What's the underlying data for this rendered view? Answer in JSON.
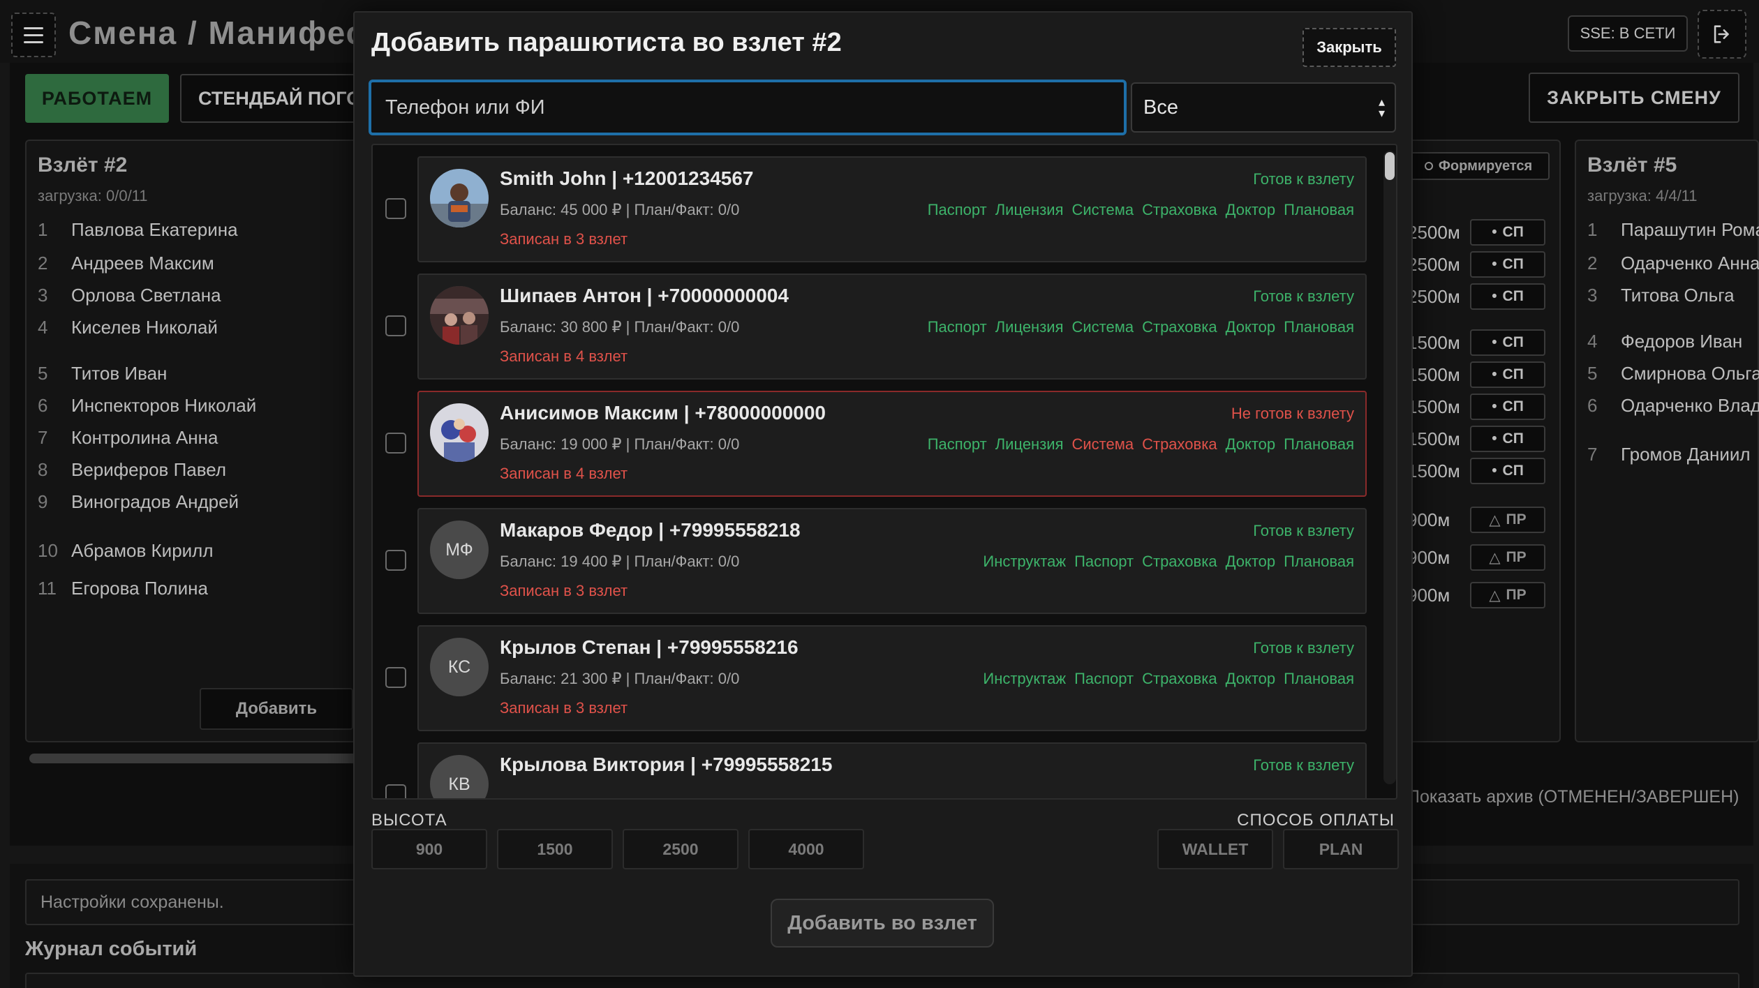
{
  "app": {
    "title": "Смена / Манифест",
    "sse_status": "SSE: В СЕТИ",
    "tab_working": "РАБОТАЕМ",
    "tab_standby": "СТЕНДБАЙ ПОГОДА",
    "close_shift": "ЗАКРЫТЬ СМЕНУ"
  },
  "left_card": {
    "title": "Взлёт #2",
    "load": "загрузка: 0/0/11",
    "add_label": "Добавить",
    "people": [
      {
        "n": "1",
        "name": "Павлова Екатерина"
      },
      {
        "n": "2",
        "name": "Андреев Максим"
      },
      {
        "n": "3",
        "name": "Орлова Светлана"
      },
      {
        "n": "4",
        "name": "Киселев Николай"
      },
      {
        "n": "5",
        "name": "Титов Иван"
      },
      {
        "n": "6",
        "name": "Инспекторов Николай"
      },
      {
        "n": "7",
        "name": "Контролина Анна"
      },
      {
        "n": "8",
        "name": "Вериферов Павел"
      },
      {
        "n": "9",
        "name": "Виноградов Андрей"
      },
      {
        "n": "10",
        "name": "Абрамов Кирилл"
      },
      {
        "n": "11",
        "name": "Егорова Полина"
      }
    ]
  },
  "mid_card": {
    "status": "Формируется",
    "rows": [
      {
        "alt": "2500м",
        "tag": "СП",
        "kind": "sp"
      },
      {
        "alt": "2500м",
        "tag": "СП",
        "kind": "sp"
      },
      {
        "alt": "2500м",
        "tag": "СП",
        "kind": "sp"
      },
      {
        "alt": "1500м",
        "tag": "СП",
        "kind": "sp"
      },
      {
        "alt": "1500м",
        "tag": "СП",
        "kind": "sp"
      },
      {
        "alt": "1500м",
        "tag": "СП",
        "kind": "sp"
      },
      {
        "alt": "1500м",
        "tag": "СП",
        "kind": "sp"
      },
      {
        "alt": "1500м",
        "tag": "СП",
        "kind": "sp"
      },
      {
        "alt": "900м",
        "tag": "ПР",
        "kind": "pr"
      },
      {
        "alt": "900м",
        "tag": "ПР",
        "kind": "pr"
      },
      {
        "alt": "900м",
        "tag": "ПР",
        "kind": "pr"
      }
    ],
    "archive": "Показать архив (ОТМЕНЕН/ЗАВЕРШЕН)"
  },
  "right_card": {
    "title": "Взлёт #5",
    "load": "загрузка: 4/4/11",
    "people": [
      {
        "n": "1",
        "name": "Парашутин Роман"
      },
      {
        "n": "2",
        "name": "Одарченко Анна"
      },
      {
        "n": "3",
        "name": "Титова Ольга"
      },
      {
        "n": "4",
        "name": "Федоров Иван"
      },
      {
        "n": "5",
        "name": "Смирнова Ольга"
      },
      {
        "n": "6",
        "name": "Одарченко Влад"
      },
      {
        "n": "7",
        "name": "Громов Даниил"
      }
    ]
  },
  "bottom": {
    "toast": "Настройки сохранены.",
    "journal_title": "Журнал событий"
  },
  "modal": {
    "title": "Добавить парашютиста во взлет #2",
    "close_label": "Закрыть",
    "search_placeholder": "Телефон или ФИ",
    "filter_value": "Все",
    "altitude_label": "ВЫСОТА",
    "payment_label": "СПОСОБ ОПЛАТЫ",
    "altitudes": [
      "900",
      "1500",
      "2500",
      "4000"
    ],
    "payments": [
      "WALLET",
      "PLAN"
    ],
    "submit_label": "Добавить во взлет",
    "candidates": [
      {
        "name": "Smith John | +12001234567",
        "balance": "Баланс: 45 000 ₽ | План/Факт: 0/0",
        "recorded": "Записан в 3 взлет",
        "state": "Готов к взлету",
        "ready": true,
        "avatar_kind": "photo1",
        "initials": "",
        "docs": [
          {
            "label": "Паспорт",
            "ok": true
          },
          {
            "label": "Лицензия",
            "ok": true
          },
          {
            "label": "Система",
            "ok": true
          },
          {
            "label": "Страховка",
            "ok": true
          },
          {
            "label": "Доктор",
            "ok": true
          },
          {
            "label": "Плановая",
            "ok": true
          }
        ]
      },
      {
        "name": "Шипаев Антон | +70000000004",
        "balance": "Баланс: 30 800 ₽ | План/Факт: 0/0",
        "recorded": "Записан в 4 взлет",
        "state": "Готов к взлету",
        "ready": true,
        "avatar_kind": "photo2",
        "initials": "",
        "docs": [
          {
            "label": "Паспорт",
            "ok": true
          },
          {
            "label": "Лицензия",
            "ok": true
          },
          {
            "label": "Система",
            "ok": true
          },
          {
            "label": "Страховка",
            "ok": true
          },
          {
            "label": "Доктор",
            "ok": true
          },
          {
            "label": "Плановая",
            "ok": true
          }
        ]
      },
      {
        "name": "Анисимов Максим | +78000000000",
        "balance": "Баланс: 19 000 ₽ | План/Факт: 0/0",
        "recorded": "Записан в 4 взлет",
        "state": "Не готов к взлету",
        "ready": false,
        "avatar_kind": "photo3",
        "initials": "",
        "docs": [
          {
            "label": "Паспорт",
            "ok": true
          },
          {
            "label": "Лицензия",
            "ok": true
          },
          {
            "label": "Система",
            "ok": false
          },
          {
            "label": "Страховка",
            "ok": false
          },
          {
            "label": "Доктор",
            "ok": true
          },
          {
            "label": "Плановая",
            "ok": true
          }
        ]
      },
      {
        "name": "Макаров Федор | +79995558218",
        "balance": "Баланс: 19 400 ₽ | План/Факт: 0/0",
        "recorded": "Записан в 3 взлет",
        "state": "Готов к взлету",
        "ready": true,
        "avatar_kind": "initials",
        "initials": "МФ",
        "docs": [
          {
            "label": "Инструктаж",
            "ok": true
          },
          {
            "label": "Паспорт",
            "ok": true
          },
          {
            "label": "Страховка",
            "ok": true
          },
          {
            "label": "Доктор",
            "ok": true
          },
          {
            "label": "Плановая",
            "ok": true
          }
        ]
      },
      {
        "name": "Крылов Степан | +79995558216",
        "balance": "Баланс: 21 300 ₽ | План/Факт: 0/0",
        "recorded": "Записан в 3 взлет",
        "state": "Готов к взлету",
        "ready": true,
        "avatar_kind": "initials",
        "initials": "КС",
        "docs": [
          {
            "label": "Инструктаж",
            "ok": true
          },
          {
            "label": "Паспорт",
            "ok": true
          },
          {
            "label": "Страховка",
            "ok": true
          },
          {
            "label": "Доктор",
            "ok": true
          },
          {
            "label": "Плановая",
            "ok": true
          }
        ]
      },
      {
        "name": "Крылова Виктория | +79995558215",
        "balance": "",
        "recorded": "",
        "state": "Готов к взлету",
        "ready": true,
        "avatar_kind": "initials",
        "initials": "КВ",
        "docs": []
      }
    ]
  }
}
